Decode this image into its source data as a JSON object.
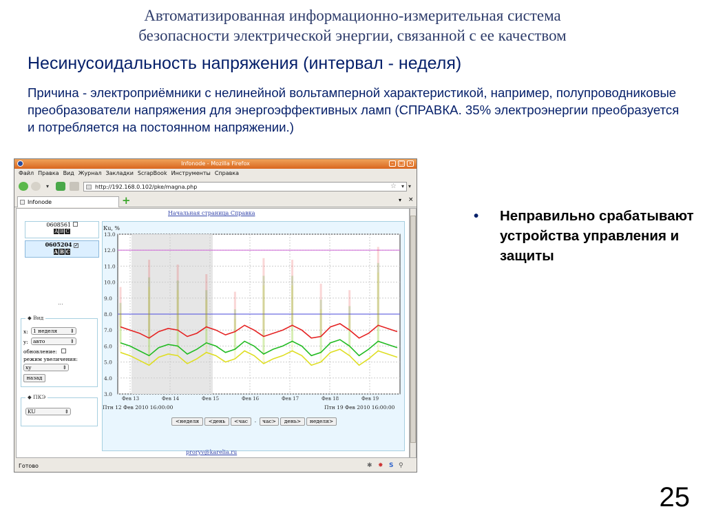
{
  "slide": {
    "title_line1": "Автоматизированная информационно-измерительная система",
    "title_line2": "безопасности электрической энергии, связанной с ее качеством",
    "subtitle": "Несинусоидальность напряжения (интервал - неделя)",
    "reason": "Причина - электроприёмники с нелинейной вольтамперной характеристикой, например, полупроводниковые преобразователи напряжения для энергоэффективных ламп (СПРАВКА. 35% электроэнергии преобразуется и потребляется на постоянном напряжении.)",
    "bullet_marker": "•",
    "bullet_text": "Неправильно срабатывают устройства управления и защиты",
    "page_number": "25"
  },
  "browser": {
    "window_title": "Infonode - Mozilla Firefox",
    "menu": [
      "Файл",
      "Правка",
      "Вид",
      "Журнал",
      "Закладки",
      "ScrapBook",
      "Инструменты",
      "Справка"
    ],
    "url": "http://192.168.0.102/pke/magna.php",
    "tab_label": "Infonode",
    "status": "Готово"
  },
  "page": {
    "links": "Начальная страница Справка",
    "device1": "0608561",
    "device2": "0605204",
    "abc": [
      "A",
      "B",
      "C"
    ],
    "dots": "...",
    "view_legend": "Вид",
    "x_label": "x:",
    "x_value": "1 неделя",
    "y_label": "y:",
    "y_value": "авто",
    "refresh_label": "обновление:",
    "zoom_label": "режим увеличения:",
    "zoom_value": "xy",
    "back_button": "назад",
    "pke_legend": "ПКЭ",
    "pke_value": "KU",
    "email": "proryv@karelia.ru",
    "nav_buttons": [
      "<неделя",
      "<день",
      "<час",
      ".",
      "час>",
      "день>",
      "неделя>"
    ]
  },
  "chart_data": {
    "type": "line",
    "ylabel": "Кu, %",
    "ylim": [
      3.0,
      13.0
    ],
    "yticks": [
      "13.0",
      "12.0",
      "11.0",
      "10.0",
      "9.0",
      "8.0",
      "7.0",
      "6.0",
      "5.0",
      "4.0",
      "3.0"
    ],
    "xticks": [
      "Фев 13",
      "Фев 14",
      "Фев 15",
      "Фев 16",
      "Фев 17",
      "Фев 18",
      "Фев 19"
    ],
    "start_label": "Птн 12 Фев 2010 16:00:00",
    "end_label": "Птн 19 Фев 2010 16:00:00",
    "grid": true,
    "threshold_lines": [
      {
        "value": 12.0,
        "color": "#d070d8"
      },
      {
        "value": 8.0,
        "color": "#6a6ae0"
      }
    ],
    "colors": {
      "red": "#e52222",
      "green": "#22bb22",
      "yellow": "#dede22"
    },
    "series": [
      {
        "values": [
          7.2,
          7.0,
          6.8,
          6.5,
          6.9,
          7.1,
          7.0,
          6.6,
          6.8,
          7.2,
          7.0,
          6.7,
          6.9,
          7.3,
          7.0,
          6.6,
          6.8,
          7.0,
          7.3,
          7.0,
          6.5,
          6.6,
          7.2,
          7.4,
          7.0,
          6.5,
          6.8,
          7.3,
          7.1,
          6.9
        ]
      },
      {
        "values": [
          6.2,
          6.0,
          5.7,
          5.4,
          5.9,
          6.1,
          6.0,
          5.5,
          5.8,
          6.2,
          6.0,
          5.6,
          5.8,
          6.3,
          6.0,
          5.5,
          5.8,
          6.0,
          6.3,
          6.0,
          5.4,
          5.6,
          6.2,
          6.4,
          6.0,
          5.4,
          5.8,
          6.3,
          6.1,
          5.9
        ]
      },
      {
        "values": [
          5.6,
          5.4,
          5.1,
          4.8,
          5.3,
          5.5,
          5.4,
          4.9,
          5.2,
          5.6,
          5.4,
          5.0,
          5.2,
          5.7,
          5.4,
          4.9,
          5.2,
          5.4,
          5.7,
          5.4,
          4.8,
          5.0,
          5.6,
          5.8,
          5.4,
          4.8,
          5.2,
          5.7,
          5.5,
          5.3
        ]
      }
    ]
  }
}
